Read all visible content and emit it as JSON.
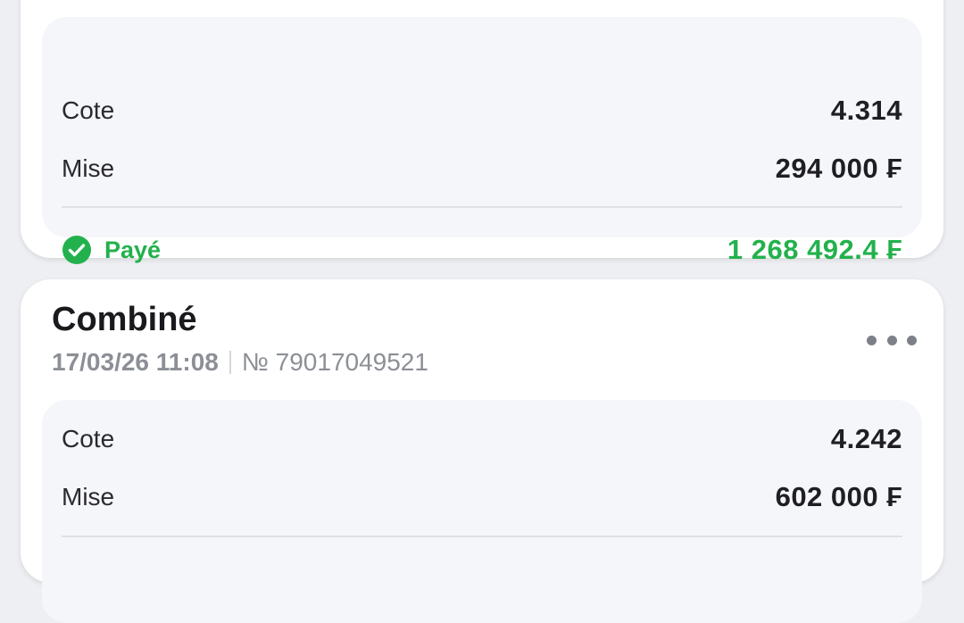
{
  "colors": {
    "success": "#23b14d",
    "background": "#eeeff2",
    "card": "#ffffff",
    "details": "#f5f6f9"
  },
  "bet1": {
    "odds_label": "Cote",
    "odds_value": "4.314",
    "stake_label": "Mise",
    "stake_value": "294 000 ₣",
    "status_icon": "check-circle-icon",
    "status_label": "Payé",
    "payout_value": "1 268 492.4 ₣"
  },
  "bet2": {
    "title": "Combiné",
    "date": "17/03/26 11:08",
    "number": "№ 79017049521",
    "more_icon": "more-horizontal-icon",
    "odds_label": "Cote",
    "odds_value": "4.242",
    "stake_label": "Mise",
    "stake_value": "602 000 ₣"
  }
}
